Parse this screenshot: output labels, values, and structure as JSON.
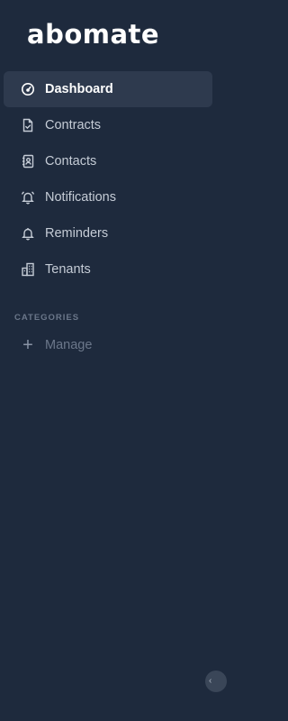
{
  "brand": {
    "logo_text": "abomate"
  },
  "nav": {
    "items": [
      {
        "label": "Dashboard",
        "icon": "dashboard-gauge-icon",
        "active": true
      },
      {
        "label": "Contracts",
        "icon": "contract-document-icon",
        "active": false
      },
      {
        "label": "Contacts",
        "icon": "contact-book-icon",
        "active": false
      },
      {
        "label": "Notifications",
        "icon": "alarm-bell-icon",
        "active": false
      },
      {
        "label": "Reminders",
        "icon": "bell-icon",
        "active": false
      },
      {
        "label": "Tenants",
        "icon": "building-icon",
        "active": false
      }
    ]
  },
  "categories": {
    "title": "CATEGORIES",
    "manage_label": "Manage",
    "manage_icon": "plus-icon"
  },
  "collapse": {
    "glyph": "‹",
    "icon": "chevron-left-icon"
  },
  "colors": {
    "background": "#1e2a3d",
    "active_item": "#2e3a4e",
    "text": "#c5ccd6",
    "muted": "#6b778a"
  }
}
